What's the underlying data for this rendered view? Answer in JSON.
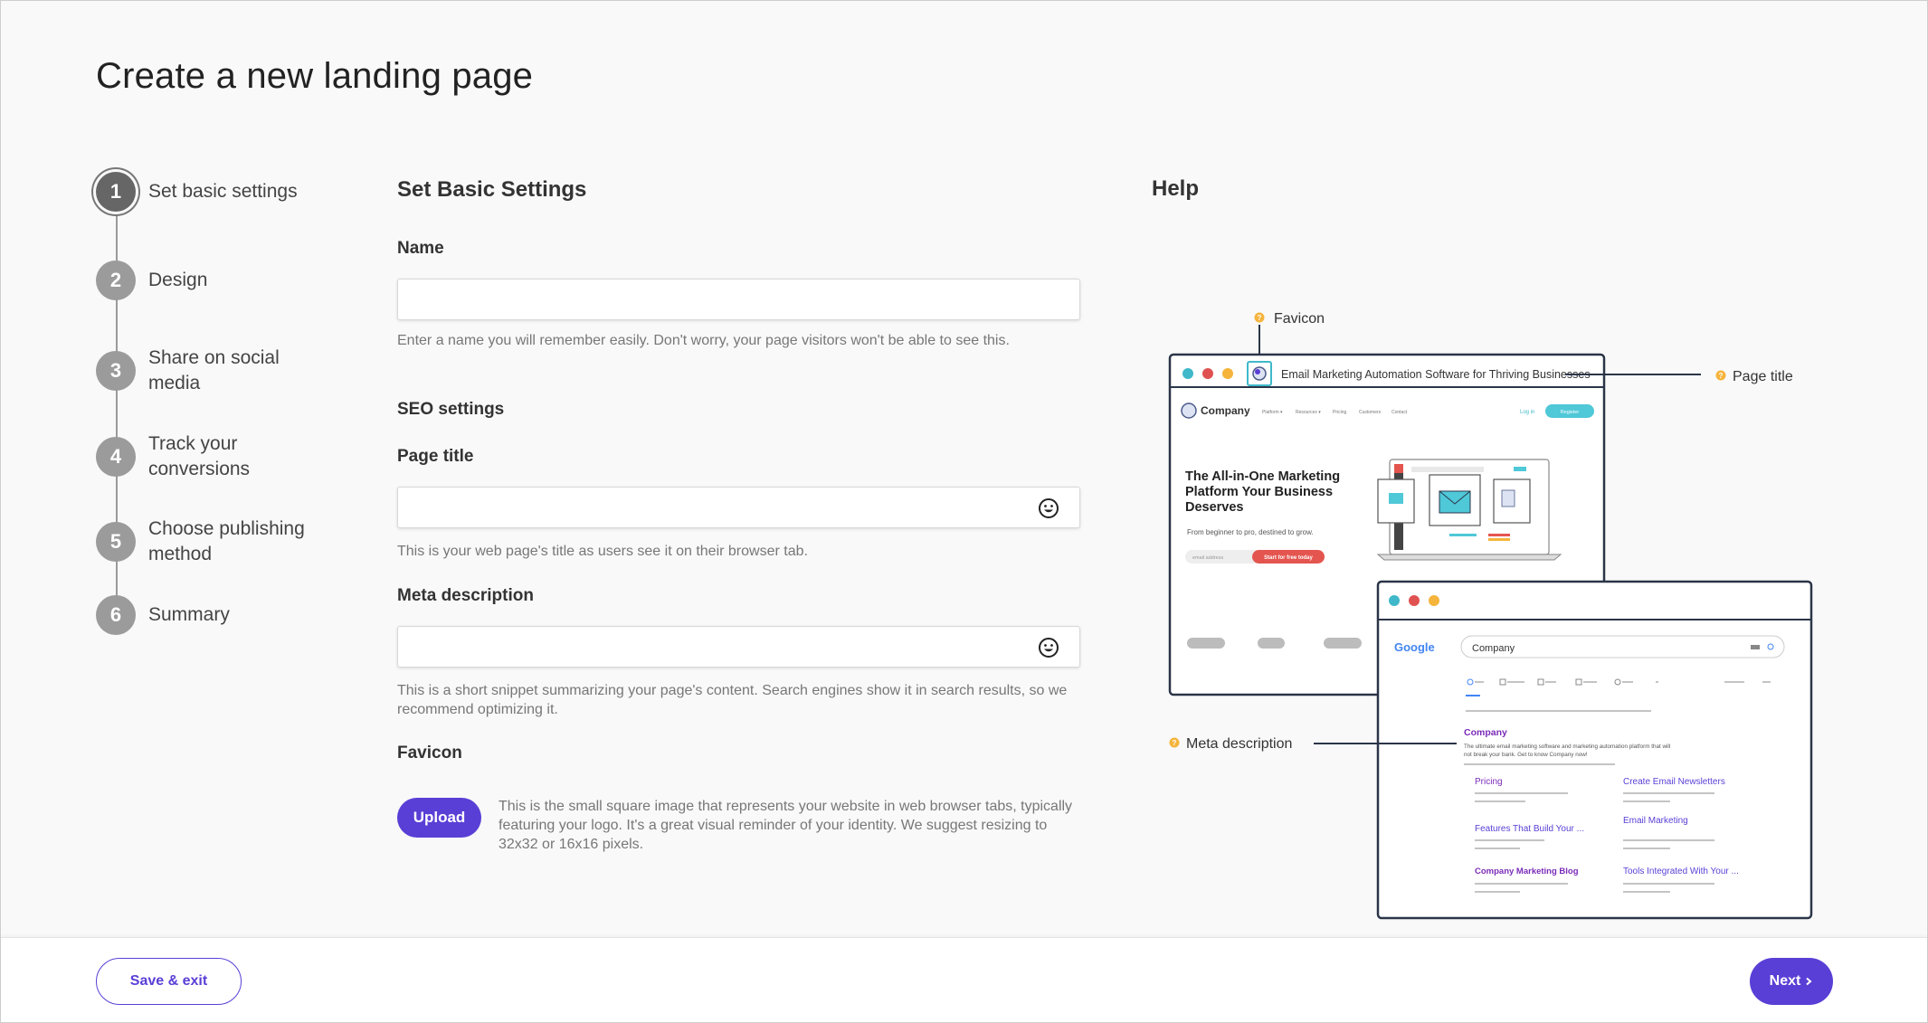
{
  "page": {
    "title": "Create a new landing page"
  },
  "steps": [
    {
      "num": "1",
      "label": "Set basic settings",
      "active": true
    },
    {
      "num": "2",
      "label": "Design"
    },
    {
      "num": "3",
      "label": "Share on social media"
    },
    {
      "num": "4",
      "label": "Track your conversions"
    },
    {
      "num": "5",
      "label": "Choose publishing method"
    },
    {
      "num": "6",
      "label": "Summary"
    }
  ],
  "form": {
    "section_title": "Set Basic Settings",
    "name": {
      "label": "Name",
      "value": "",
      "hint": "Enter a name you will remember easily. Don't worry, your page visitors won't be able to see this."
    },
    "seo_title": "SEO settings",
    "page_title": {
      "label": "Page title",
      "value": "",
      "hint": "This is your web page's title as users see it on their browser tab."
    },
    "meta_description": {
      "label": "Meta description",
      "value": "",
      "hint": "This is a short snippet summarizing your page's content. Search engines show it in search results, so we recommend optimizing it."
    },
    "favicon": {
      "label": "Favicon",
      "upload_label": "Upload",
      "hint": "This is the small square image that represents your website in web browser tabs, typically featuring your logo. It's a great visual reminder of your identity. We suggest resizing to 32x32 or 16x16 pixels."
    }
  },
  "help": {
    "title": "Help",
    "callouts": {
      "favicon": "Favicon",
      "page_title": "Page title",
      "meta_description": "Meta description"
    },
    "browser_tab_title": "Email Marketing Automation Software for Thriving Businesses",
    "site": {
      "brand": "Company",
      "nav": [
        "Platform ▾",
        "Resources ▾",
        "Pricing",
        "Customers",
        "Contact"
      ],
      "login": "Log in",
      "register": "Register",
      "headline": [
        "The All-in-One Marketing",
        "Platform Your Business",
        "Deserves"
      ],
      "subtext": "From beginner to pro, destined to grow.",
      "email_placeholder": "email address",
      "cta": "Start for free today"
    },
    "search": {
      "engine": "Google",
      "query": "Company",
      "result_title": "Company",
      "result_desc": [
        "The ultimate email marketing software and marketing automation platform that will",
        "not break your bank. Get to know Company now!"
      ],
      "links": [
        "Pricing",
        "Create Email Newsletters",
        "Features That Build Your ...",
        "Email Marketing",
        "Company Marketing Blog",
        "Tools Integrated With Your ..."
      ]
    }
  },
  "footer": {
    "save_label": "Save & exit",
    "next_label": "Next"
  },
  "colors": {
    "accent": "#5a3fd6",
    "callout_dot": "#f5b43c",
    "link_purple": "#7a2bb8",
    "navy": "#2b3548"
  }
}
